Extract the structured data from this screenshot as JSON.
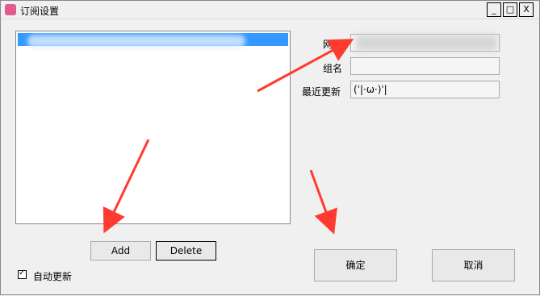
{
  "window": {
    "title": "订阅设置",
    "controls": {
      "minimize": "_",
      "maximize": "□",
      "close": "X"
    }
  },
  "form": {
    "url_label": "网址",
    "group_label": "组名",
    "group_value": "",
    "last_update_label": "最近更新",
    "last_update_value": "(ˈ|·ω·)ˈ|"
  },
  "list": {
    "selected_item": ""
  },
  "buttons": {
    "add": "Add",
    "delete": "Delete",
    "ok": "确定",
    "cancel": "取消"
  },
  "auto_update": {
    "label": "自动更新",
    "checked": true,
    "check_glyph": "✓"
  },
  "colors": {
    "selection": "#3399ff",
    "arrow": "#ff3b30"
  }
}
